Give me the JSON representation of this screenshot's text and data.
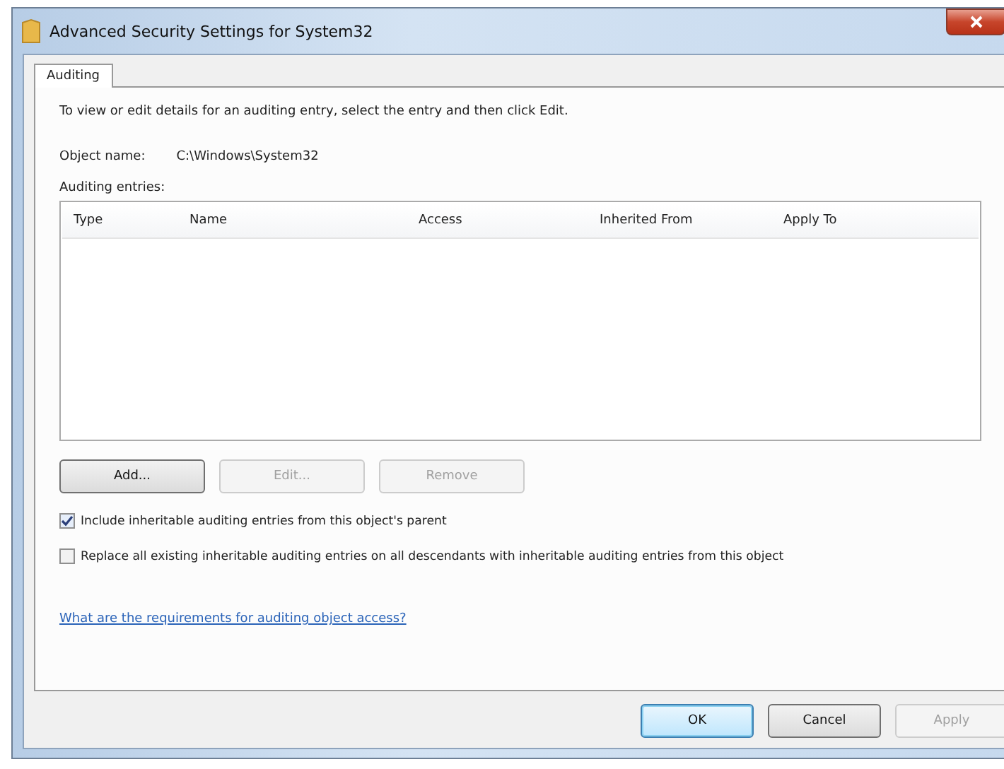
{
  "window": {
    "title": "Advanced Security Settings for System32"
  },
  "tabs": [
    {
      "label": "Auditing",
      "selected": true
    }
  ],
  "instructions": "To view or edit details for an auditing entry, select the entry and then click Edit.",
  "object_name": {
    "label": "Object name:",
    "value": "C:\\Windows\\System32"
  },
  "entries_label": "Auditing entries:",
  "table": {
    "columns": [
      "Type",
      "Name",
      "Access",
      "Inherited From",
      "Apply To"
    ]
  },
  "entry_buttons": [
    {
      "label": "Add...",
      "disabled": false
    },
    {
      "label": "Edit...",
      "disabled": true
    },
    {
      "label": "Remove",
      "disabled": true
    }
  ],
  "checkboxes": [
    {
      "label": "Include inheritable auditing entries from this object's parent",
      "checked": true
    },
    {
      "label": "Replace all existing inheritable auditing entries on all descendants with inheritable auditing entries from this object",
      "checked": false
    }
  ],
  "help_link": "What are the requirements for auditing object access?",
  "dialog_buttons": [
    {
      "label": "OK",
      "disabled": false,
      "default": true
    },
    {
      "label": "Cancel",
      "disabled": false,
      "default": false
    },
    {
      "label": "Apply",
      "disabled": true,
      "default": false
    }
  ]
}
